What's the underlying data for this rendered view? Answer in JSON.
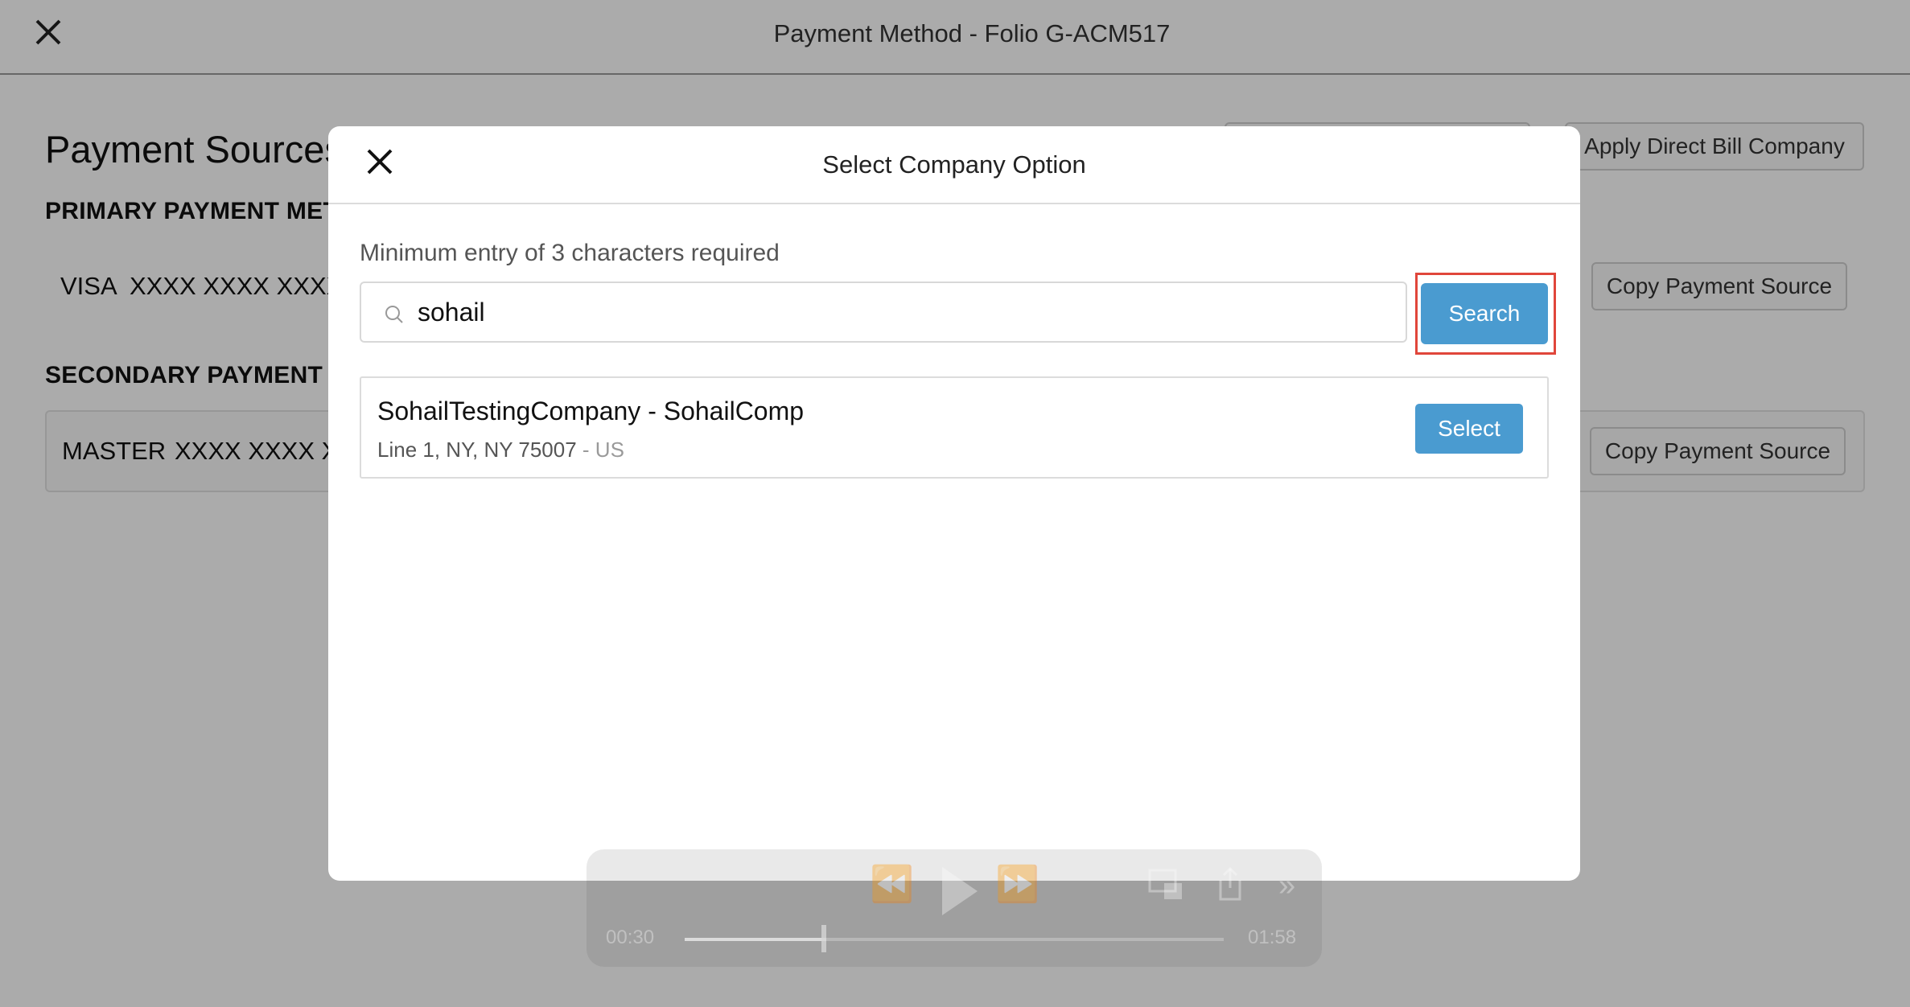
{
  "window": {
    "title": "Payment Method - Folio G-ACM517"
  },
  "page": {
    "heading": "Payment Sources",
    "primary": {
      "label": "PRIMARY PAYMENT MET",
      "card_brand": "VISA",
      "card_number": "XXXX XXXX XXXX"
    },
    "secondary": {
      "label": "SECONDARY PAYMENT M",
      "card_brand": "MASTER",
      "card_number": "XXXX XXXX X"
    },
    "buttons": {
      "apply_direct_bill": "Apply Direct Bill Company",
      "copy_primary": "Copy Payment Source",
      "copy_secondary": "Copy Payment Source"
    }
  },
  "modal": {
    "title": "Select Company Option",
    "hint": "Minimum entry of 3 characters required",
    "search": {
      "value": "sohail",
      "button_label": "Search"
    },
    "results": [
      {
        "name": "SohailTestingCompany - SohailComp",
        "address": "Line 1, NY, NY 75007",
        "country_suffix": " - US",
        "button_label": "Select"
      }
    ]
  },
  "video_controls": {
    "current_time": "00:30",
    "duration": "01:58",
    "progress_fraction": 0.25
  },
  "colors": {
    "accent": "#4a9bd0",
    "highlight": "#e0463b",
    "overlay": "rgba(0,0,0,0.33)"
  }
}
